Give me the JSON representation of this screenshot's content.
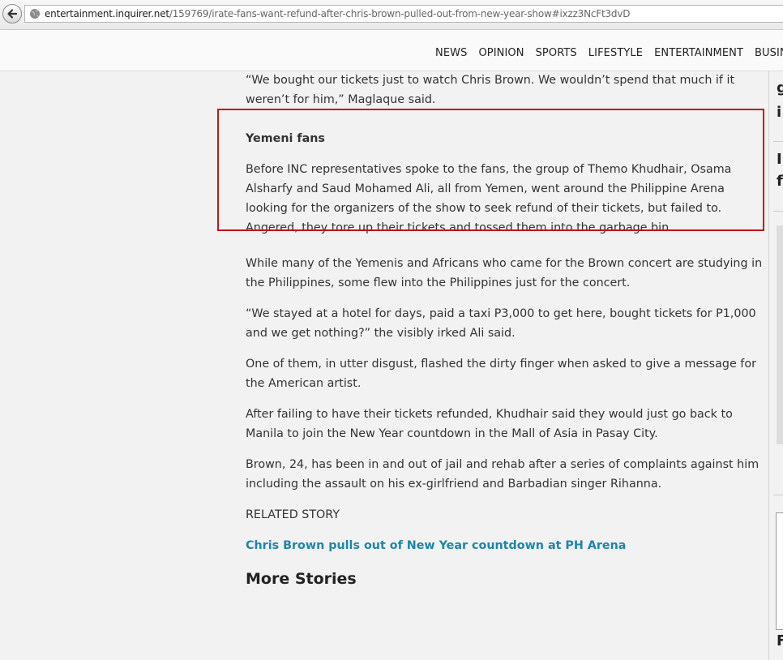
{
  "browser": {
    "url_host": "entertainment.inquirer.net",
    "url_path": "/159769/irate-fans-want-refund-after-chris-brown-pulled-out-from-new-year-show#ixzz3NcFt3dvD"
  },
  "nav": {
    "items": [
      "NEWS",
      "OPINION",
      "SPORTS",
      "LIFESTYLE",
      "ENTERTAINMENT",
      "BUSINESS"
    ]
  },
  "article": {
    "para_quote": "“We bought our tickets just to watch Chris Brown. We wouldn’t spend that much if it weren’t for him,” Maglaque said.",
    "subhead": "Yemeni fans",
    "para_yemeni": "Before INC representatives spoke to the fans, the group of Themo Khudhair, Osama Alsharfy and Saud Mohamed Ali, all from Yemen, went around the Philippine Arena looking for the organizers of the show to seek refund of their tickets, but failed to. Angered, they tore up their tickets and tossed them into the garbage bin.",
    "para_students": "While many of the Yemenis and Africans who came for the Brown concert are studying in the Philippines, some flew into the Philippines just for the concert.",
    "para_hotel": "“We stayed at a hotel for days, paid a taxi P3,000 to get here, bought tickets for P1,000 and we get nothing?” the visibly irked Ali said.",
    "para_disgust": "One of them, in utter disgust, flashed the dirty finger when asked to give a message for the American artist.",
    "para_manila": "After failing to have their tickets refunded, Khudhair said they would just go back to Manila to join the New Year countdown in the Mall of Asia in Pasay City.",
    "para_brown": "Brown, 24, has been in and out of jail and rehab after a series of complaints against him including the assault on his ex-girlfriend and Barbadian singer Rihanna.",
    "related_label": "RELATED STORY",
    "related_link": "Chris Brown pulls out of New Year countdown at PH Arena",
    "more_stories": "More Stories"
  },
  "sidebar": {
    "fragments": [
      "g",
      "i",
      "I",
      "f",
      "F"
    ]
  },
  "colors": {
    "highlight_border": "#c0151c",
    "link": "#1f86a8"
  }
}
